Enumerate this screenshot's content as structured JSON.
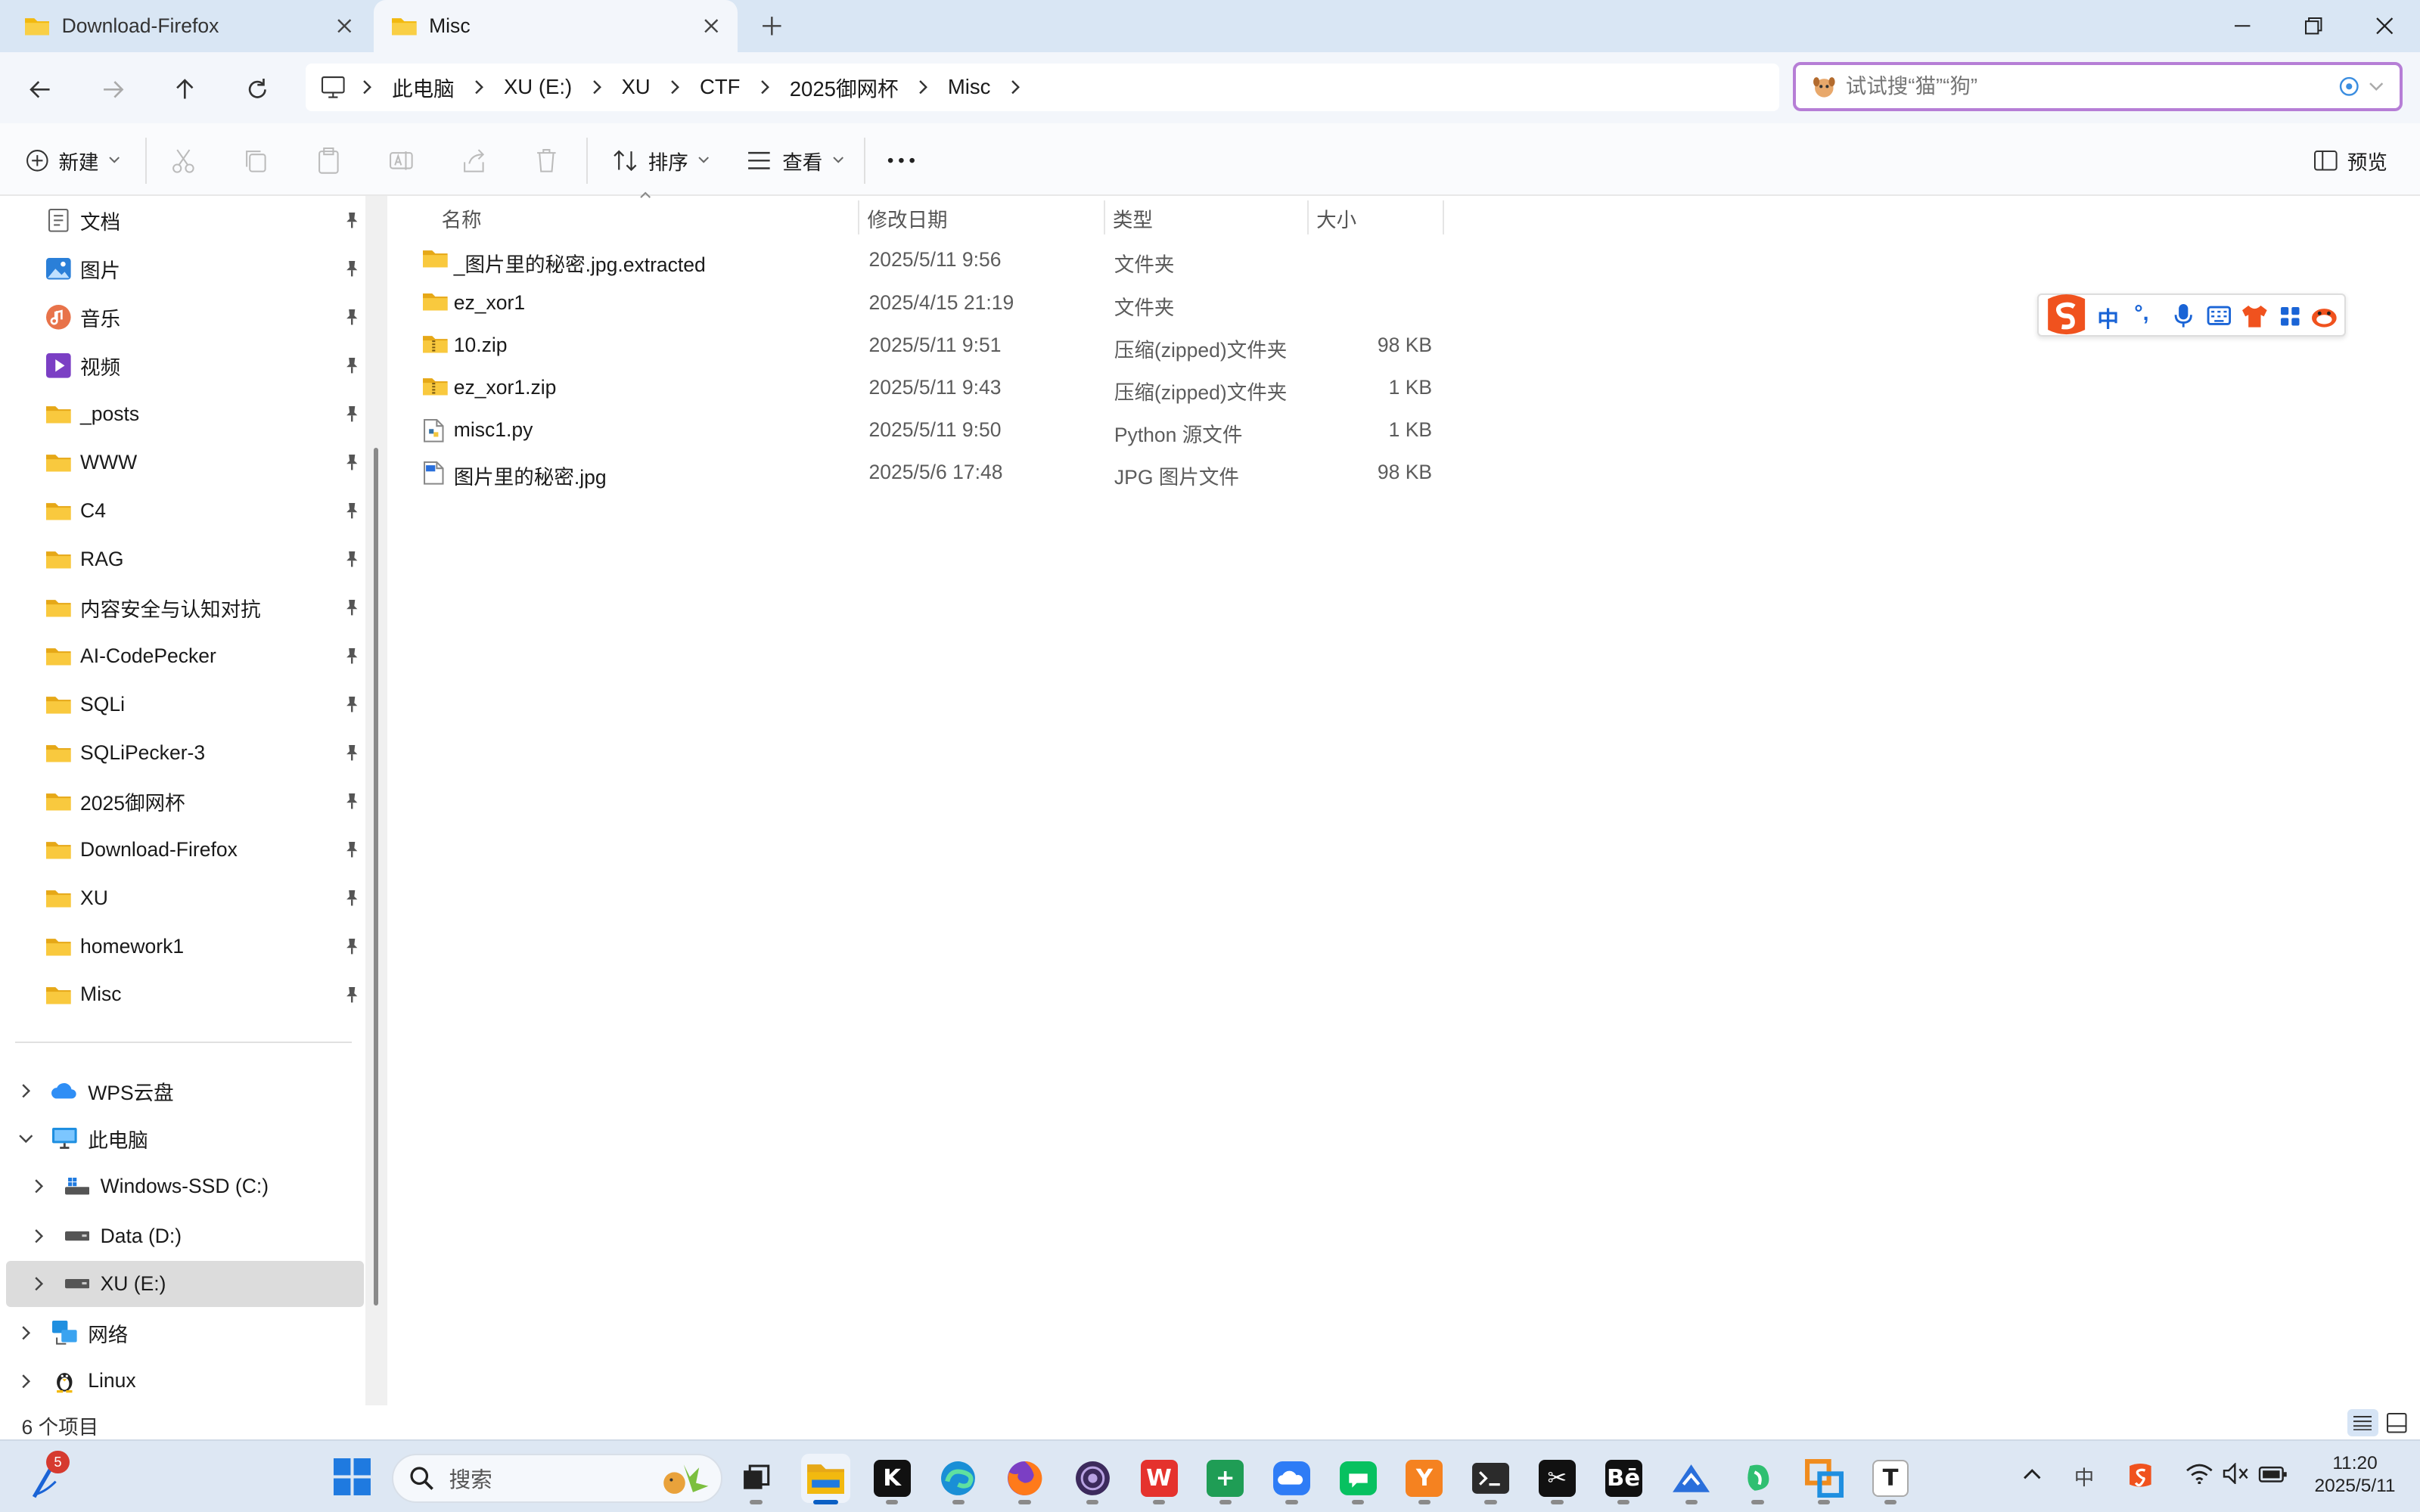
{
  "tabs": [
    {
      "label": "Download-Firefox",
      "active": false
    },
    {
      "label": "Misc",
      "active": true
    }
  ],
  "breadcrumb": [
    "此电脑",
    "XU (E:)",
    "XU",
    "CTF",
    "2025御网杯",
    "Misc"
  ],
  "search": {
    "placeholder": "试试搜“猫”“狗”"
  },
  "toolbar": {
    "new_label": "新建",
    "sort_label": "排序",
    "view_label": "查看",
    "preview_label": "预览"
  },
  "columns": {
    "name": "名称",
    "date": "修改日期",
    "type": "类型",
    "size": "大小"
  },
  "files": [
    {
      "name": "_图片里的秘密.jpg.extracted",
      "date": "2025/5/11 9:56",
      "type": "文件夹",
      "size": "",
      "kind": "folder"
    },
    {
      "name": "ez_xor1",
      "date": "2025/4/15 21:19",
      "type": "文件夹",
      "size": "",
      "kind": "folder"
    },
    {
      "name": "10.zip",
      "date": "2025/5/11 9:51",
      "type": "压缩(zipped)文件夹",
      "size": "98 KB",
      "kind": "zip"
    },
    {
      "name": "ez_xor1.zip",
      "date": "2025/5/11 9:43",
      "type": "压缩(zipped)文件夹",
      "size": "1 KB",
      "kind": "zip"
    },
    {
      "name": "misc1.py",
      "date": "2025/5/11 9:50",
      "type": "Python 源文件",
      "size": "1 KB",
      "kind": "py"
    },
    {
      "name": "图片里的秘密.jpg",
      "date": "2025/5/6 17:48",
      "type": "JPG 图片文件",
      "size": "98 KB",
      "kind": "jpg"
    }
  ],
  "quick_access": [
    {
      "label": "文档",
      "icon": "documents-icon"
    },
    {
      "label": "图片",
      "icon": "pictures-icon"
    },
    {
      "label": "音乐",
      "icon": "music-icon"
    },
    {
      "label": "视频",
      "icon": "videos-icon"
    },
    {
      "label": "_posts",
      "icon": "folder-icon"
    },
    {
      "label": "WWW",
      "icon": "folder-icon"
    },
    {
      "label": "C4",
      "icon": "folder-icon"
    },
    {
      "label": "RAG",
      "icon": "folder-icon"
    },
    {
      "label": "内容安全与认知对抗",
      "icon": "folder-icon"
    },
    {
      "label": "AI-CodePecker",
      "icon": "folder-icon"
    },
    {
      "label": "SQLi",
      "icon": "folder-icon"
    },
    {
      "label": "SQLiPecker-3",
      "icon": "folder-icon"
    },
    {
      "label": "2025御网杯",
      "icon": "folder-icon"
    },
    {
      "label": "Download-Firefox",
      "icon": "folder-icon"
    },
    {
      "label": "XU",
      "icon": "folder-icon"
    },
    {
      "label": "homework1",
      "icon": "folder-icon"
    },
    {
      "label": "Misc",
      "icon": "folder-icon"
    }
  ],
  "tree": [
    {
      "label": "WPS云盘",
      "icon": "wps-cloud-icon",
      "expanded": false,
      "level": 0,
      "selected": false
    },
    {
      "label": "此电脑",
      "icon": "this-pc-icon",
      "expanded": true,
      "level": 0,
      "selected": false
    },
    {
      "label": "Windows-SSD (C:)",
      "icon": "windows-drive-icon",
      "expanded": false,
      "level": 1,
      "selected": false
    },
    {
      "label": "Data (D:)",
      "icon": "drive-icon",
      "expanded": false,
      "level": 1,
      "selected": false
    },
    {
      "label": "XU (E:)",
      "icon": "drive-icon",
      "expanded": false,
      "level": 1,
      "selected": true
    },
    {
      "label": "网络",
      "icon": "network-icon",
      "expanded": false,
      "level": 0,
      "selected": false
    },
    {
      "label": "Linux",
      "icon": "linux-icon",
      "expanded": false,
      "level": 0,
      "selected": false
    }
  ],
  "status": {
    "count": "6 个项目"
  },
  "ime": {
    "lang": "中",
    "punct": "°,"
  },
  "taskbar": {
    "search_placeholder": "搜索",
    "badge": "5",
    "apps": [
      {
        "name": "task-view-icon",
        "color": "#222222",
        "on": false
      },
      {
        "name": "file-explorer-icon",
        "color": "#f2b90f",
        "on": true
      },
      {
        "name": "kimi-app-icon",
        "color": "#111111",
        "on": false
      },
      {
        "name": "edge-browser-icon",
        "color": "#1a8fd6",
        "on": false
      },
      {
        "name": "firefox-icon",
        "color": "#ff7a1a",
        "on": false
      },
      {
        "name": "tor-browser-icon",
        "color": "#3c2a5c",
        "on": false
      },
      {
        "name": "wps-office-icon",
        "color": "#e5322d",
        "on": false
      },
      {
        "name": "wps-spreadsheet-icon",
        "color": "#1f9d55",
        "on": false
      },
      {
        "name": "cloud-drive-icon",
        "color": "#2e7cf6",
        "on": false
      },
      {
        "name": "wechat-icon",
        "color": "#07c160",
        "on": false
      },
      {
        "name": "wps-pdf-icon",
        "color": "#f58220",
        "on": false
      },
      {
        "name": "terminal-icon",
        "color": "#2b2b2b",
        "on": false
      },
      {
        "name": "capcut-icon",
        "color": "#111111",
        "on": false
      },
      {
        "name": "behance-icon",
        "color": "#111111",
        "on": false
      },
      {
        "name": "ide-app-icon",
        "color": "#2a6fdb",
        "on": false
      },
      {
        "name": "green-app-icon",
        "color": "#2fbf71",
        "on": false
      },
      {
        "name": "remote-app-icon",
        "color": "#f08c1e",
        "on": false
      },
      {
        "name": "typora-icon",
        "color": "#333333",
        "on": false
      }
    ],
    "ime_indicator": "中",
    "time": "11:20",
    "date": "2025/5/11"
  }
}
